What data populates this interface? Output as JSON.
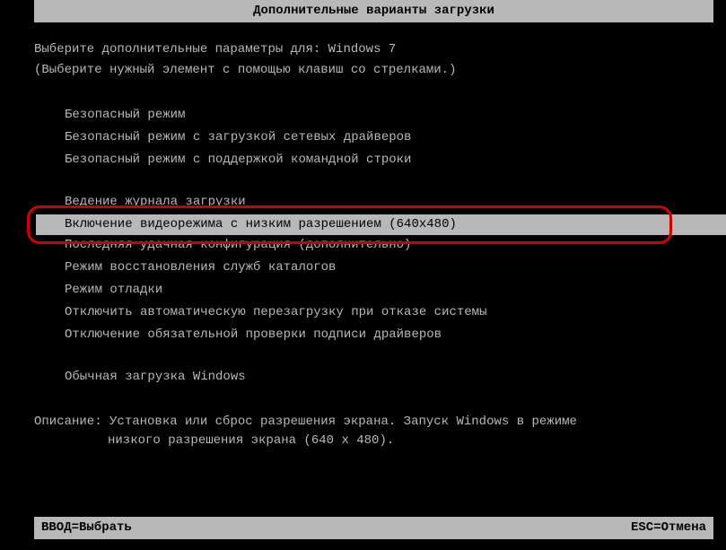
{
  "title": "Дополнительные варианты загрузки",
  "header": {
    "line1_prefix": "Выберите дополнительные параметры для: ",
    "os_name": "Windows 7",
    "line2": "(Выберите нужный элемент с помощью клавиш со стрелками.)"
  },
  "options": {
    "group1": [
      "Безопасный режим",
      "Безопасный режим с загрузкой сетевых драйверов",
      "Безопасный режим с поддержкой командной строки"
    ],
    "group2_above": "Ведение журнала загрузки",
    "selected": "Включение видеорежима с низким разрешением (640x480)",
    "group2_below": [
      "Последняя удачная конфигурация (дополнительно)",
      "Режим восстановления служб каталогов",
      "Режим отладки",
      "Отключить автоматическую перезагрузку при отказе системы",
      "Отключение обязательной проверки подписи драйверов"
    ],
    "group3": [
      "Обычная загрузка Windows"
    ]
  },
  "description": {
    "label": "Описание: ",
    "line1": "Установка или сброс разрешения экрана. Запуск Windows в режиме",
    "line2": "низкого разрешения экрана (640 x 480)."
  },
  "footer": {
    "left": "ВВОД=Выбрать",
    "right": "ESC=Отмена"
  }
}
